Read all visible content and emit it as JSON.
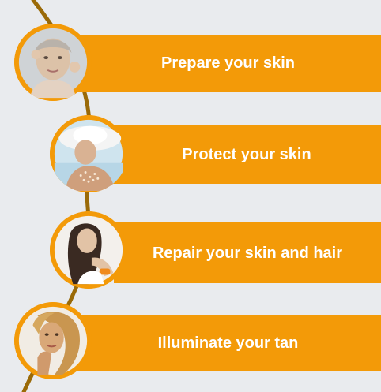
{
  "steps": [
    {
      "label": "Prepare your skin",
      "icon": "woman-applying-cream-photo"
    },
    {
      "label": "Protect your skin",
      "icon": "woman-sun-hat-photo"
    },
    {
      "label": "Repair your skin and hair",
      "icon": "woman-long-hair-photo"
    },
    {
      "label": "Illuminate your tan",
      "icon": "woman-golden-tan-photo"
    }
  ],
  "colors": {
    "accent": "#f39a08",
    "line": "#9a6a08",
    "background": "#e9ebee",
    "text": "#ffffff"
  }
}
